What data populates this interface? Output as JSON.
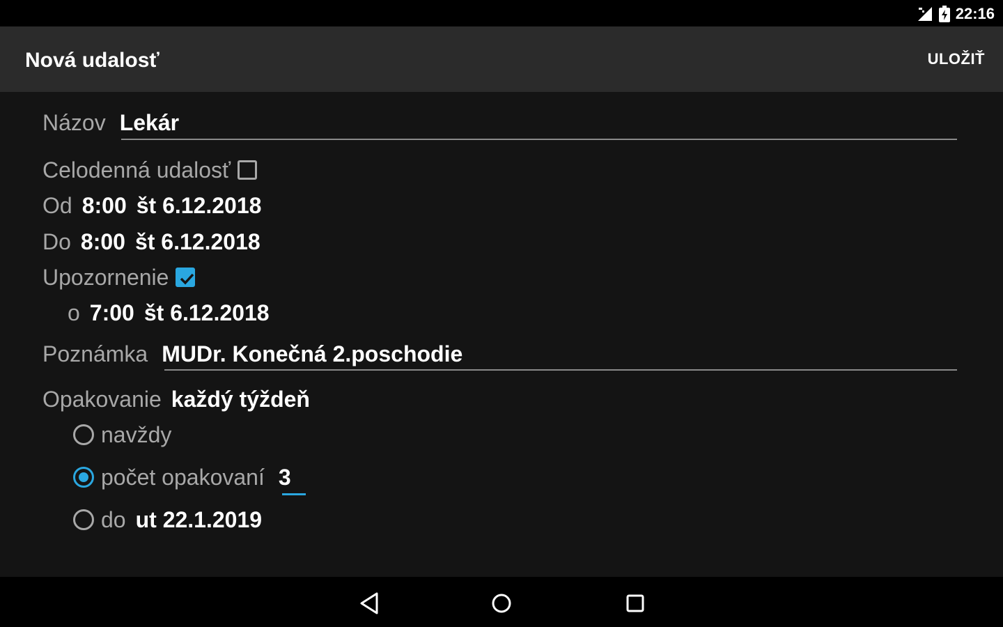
{
  "status": {
    "time": "22:16"
  },
  "appbar": {
    "title": "Nová udalosť",
    "save_label": "ULOŽIŤ"
  },
  "form": {
    "name_label": "Názov",
    "name_value": "Lekár",
    "allday_label": "Celodenná udalosť",
    "allday_checked": false,
    "from_label": "Od",
    "from_time": "8:00",
    "from_date": "št 6.12.2018",
    "to_label": "Do",
    "to_time": "8:00",
    "to_date": "št 6.12.2018",
    "reminder_label": "Upozornenie",
    "reminder_checked": true,
    "reminder_at_label": "o",
    "reminder_time": "7:00",
    "reminder_date": "št 6.12.2018",
    "note_label": "Poznámka",
    "note_value": "MUDr. Konečná 2.poschodie",
    "repeat_label": "Opakovanie",
    "repeat_value": "každý týždeň",
    "repeat_options": {
      "forever_label": "navždy",
      "count_label": "počet opakovaní",
      "count_value": "3",
      "until_label": "do",
      "until_value": "ut 22.1.2019",
      "selected": "count"
    }
  },
  "colors": {
    "accent": "#2aa7e0",
    "appbar": "#2b2b2b",
    "background": "#141414"
  },
  "icons": {
    "signal": "signal-icon",
    "battery": "battery-icon",
    "back": "back-icon",
    "home": "home-icon",
    "recents": "recents-icon"
  }
}
